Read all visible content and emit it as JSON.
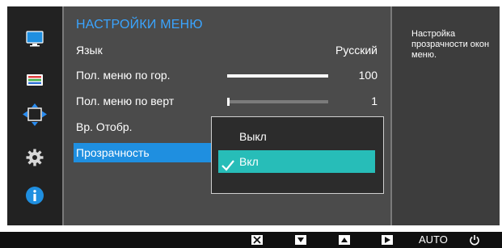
{
  "colors": {
    "accent": "#3aa4ff",
    "selected_row": "#1f8fe0",
    "selected_option": "#27bdb8"
  },
  "sidebar": {
    "items": [
      {
        "icon": "monitor-icon"
      },
      {
        "icon": "color-palette-icon"
      },
      {
        "icon": "resize-arrows-icon"
      },
      {
        "icon": "gear-icon"
      },
      {
        "icon": "info-icon"
      }
    ]
  },
  "menu": {
    "title": "НАСТРОЙКИ МЕНЮ",
    "rows": [
      {
        "label": "Язык",
        "value": "Русский"
      },
      {
        "label": "Пол. меню по гор.",
        "value": "100",
        "level": 1.0
      },
      {
        "label": "Пол. меню по верт",
        "value": "1",
        "level": 0.01
      },
      {
        "label": "Вр. Отобр.",
        "value": ""
      },
      {
        "label": "Прозрачность",
        "value": ""
      }
    ]
  },
  "dropdown": {
    "options": [
      {
        "label": "Выкл",
        "selected": false
      },
      {
        "label": "Вкл",
        "selected": true
      }
    ]
  },
  "help": {
    "text": "Настройка прозрачности окон меню."
  },
  "bottom_bar": {
    "auto_label": "AUTO",
    "icons": [
      "close-icon",
      "down-icon",
      "up-icon",
      "enter-icon",
      "power-icon"
    ]
  }
}
